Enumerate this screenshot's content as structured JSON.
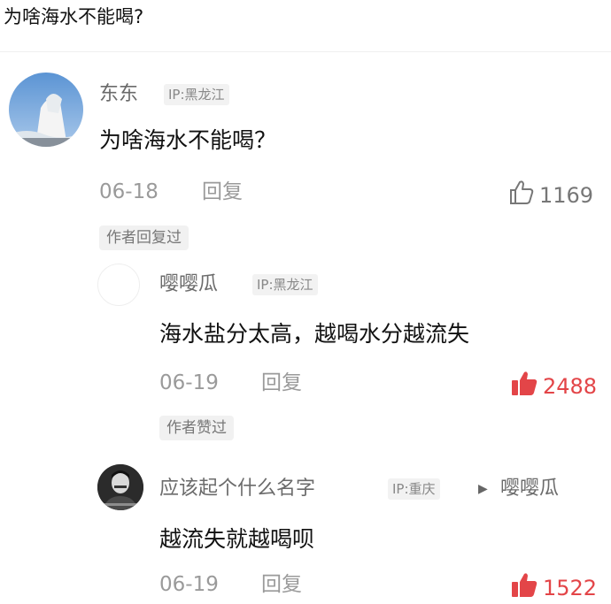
{
  "post": {
    "title": "为啥海水不能喝?"
  },
  "comments": [
    {
      "author": "东东",
      "ip": "IP:黑龙江",
      "text": "为啥海水不能喝？",
      "date": "06-18",
      "reply_label": "回复",
      "likes": "1169",
      "liked": false,
      "author_tag": "作者回复过"
    },
    {
      "author": "嘤嘤瓜",
      "ip": "IP:黑龙江",
      "text": "海水盐分太高，越喝水分越流失",
      "date": "06-19",
      "reply_label": "回复",
      "likes": "2488",
      "liked": true,
      "author_tag": "作者赞过"
    },
    {
      "author": "应该起个什么名字",
      "ip": "IP:重庆",
      "reply_to": "嘤嘤瓜",
      "text": "越流失就越喝呗",
      "date": "06-19",
      "reply_label": "回复",
      "likes": "1522",
      "liked": true
    }
  ],
  "colors": {
    "like_active": "#e34548",
    "meta": "#9a9a9a",
    "tag_bg": "#f1f1f1"
  }
}
